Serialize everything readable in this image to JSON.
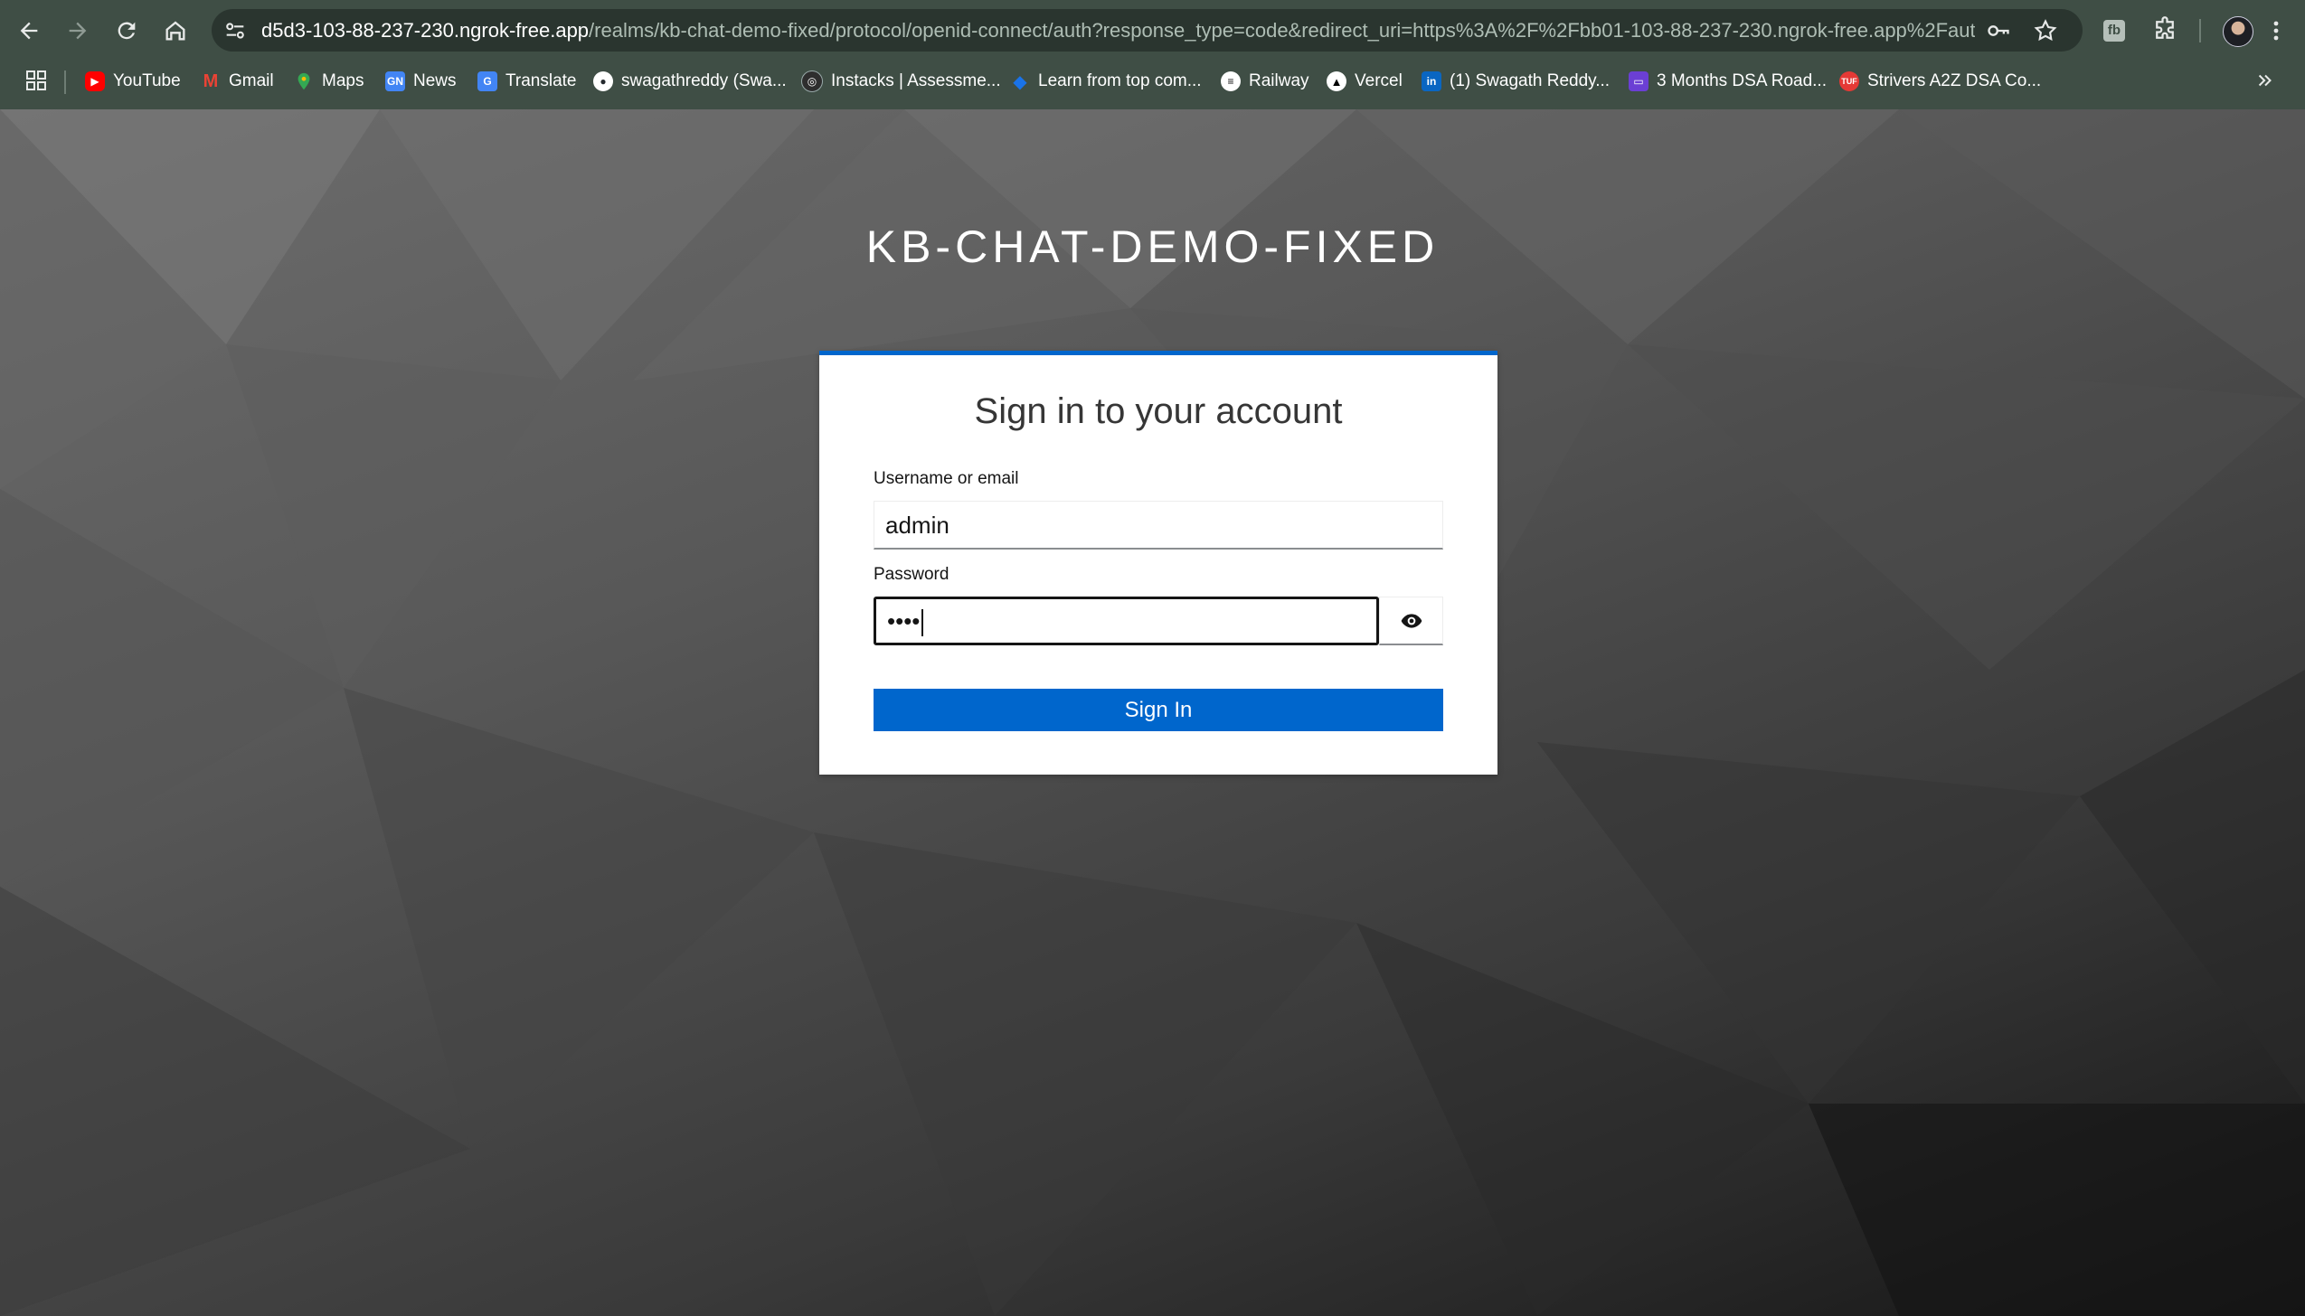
{
  "browser": {
    "url_host": "d5d3-103-88-237-230.ngrok-free.app",
    "url_path": "/realms/kb-chat-demo-fixed/protocol/openid-connect/auth?response_type=code&redirect_uri=https%3A%2F%2Fbb01-103-88-237-230.ngrok-free.app%2Fauth%2F...",
    "extension_label": "fb",
    "bookmarks": [
      {
        "label": "YouTube",
        "icon": "youtube-icon",
        "color": "#ff0000"
      },
      {
        "label": "Gmail",
        "icon": "gmail-icon",
        "color": "#ea4335"
      },
      {
        "label": "Maps",
        "icon": "maps-icon",
        "color": "#34a853"
      },
      {
        "label": "News",
        "icon": "news-icon",
        "color": "#4285f4"
      },
      {
        "label": "Translate",
        "icon": "translate-icon",
        "color": "#4285f4"
      },
      {
        "label": "swagathreddy (Swa...",
        "icon": "github-icon",
        "color": "#ffffff"
      },
      {
        "label": "Instacks | Assessme...",
        "icon": "instacks-icon",
        "color": "#2e2e2e"
      },
      {
        "label": "Learn from top com...",
        "icon": "diamond-icon",
        "color": "#1a73e8"
      },
      {
        "label": "Railway",
        "icon": "railway-icon",
        "color": "#111111"
      },
      {
        "label": "Vercel",
        "icon": "vercel-icon",
        "color": "#000000"
      },
      {
        "label": "(1) Swagath Reddy...",
        "icon": "linkedin-icon",
        "color": "#0a66c2"
      },
      {
        "label": "3 Months DSA Road...",
        "icon": "dsa-roadmap-icon",
        "color": "#6b3fd4"
      },
      {
        "label": "Strivers A2Z DSA Co...",
        "icon": "tuf-icon",
        "color": "#e53935"
      }
    ]
  },
  "login": {
    "realm_title": "KB-CHAT-DEMO-FIXED",
    "heading": "Sign in to your account",
    "username_label": "Username or email",
    "username_value": "admin",
    "password_label": "Password",
    "password_value": "••••",
    "submit_label": "Sign In"
  },
  "colors": {
    "accent": "#0066cc",
    "chrome": "#3f4e45"
  }
}
